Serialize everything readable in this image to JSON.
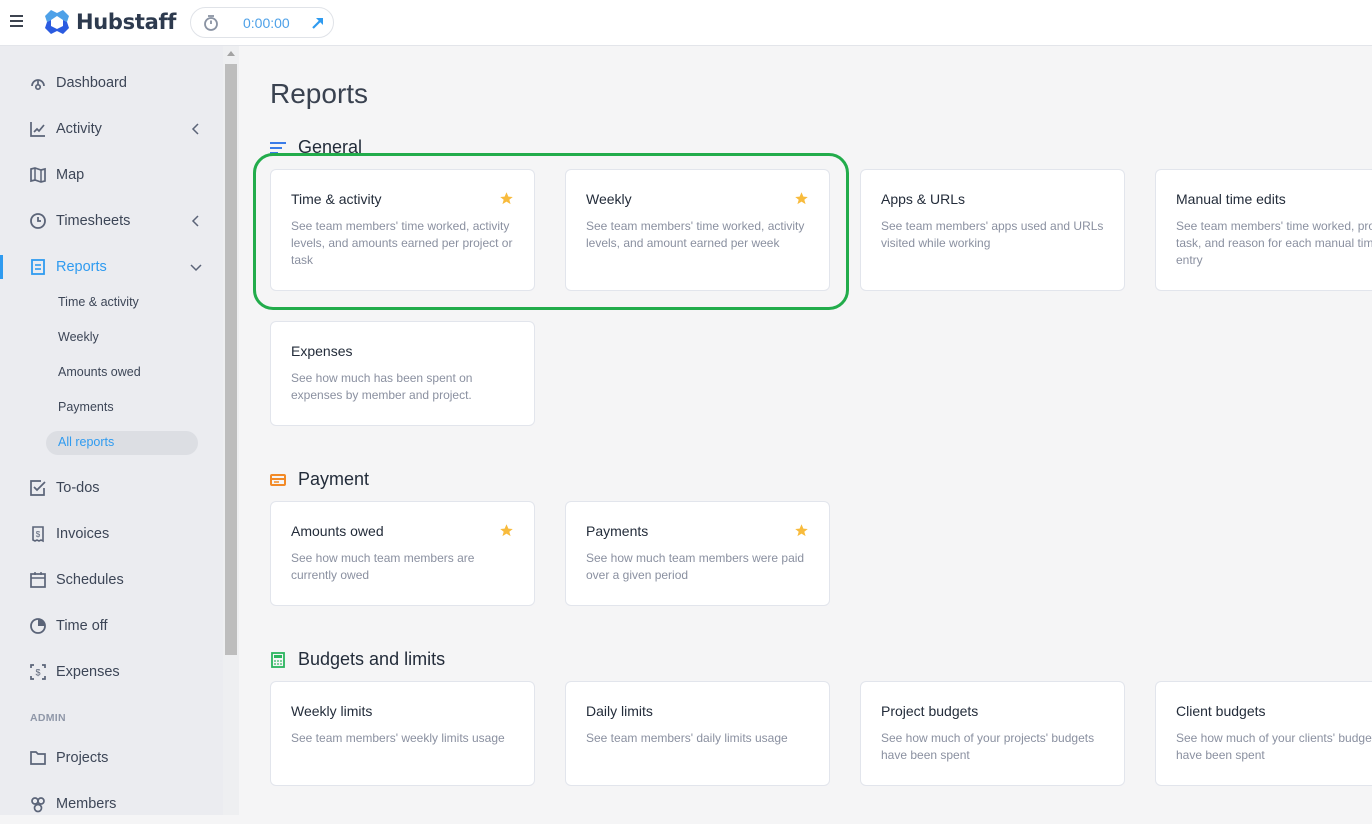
{
  "topbar": {
    "brand": "Hubstaff",
    "timer_value": "0:00:00"
  },
  "colors": {
    "accent": "#2f9bf0",
    "highlight": "#22ac4b",
    "star": "#f8bb3c",
    "payment_icon": "#f28a27",
    "budgets_icon": "#2bb55e",
    "general_icon": "#3a7ce8"
  },
  "sidebar": {
    "items": [
      {
        "label": "Dashboard",
        "icon": "dashboard-icon"
      },
      {
        "label": "Activity",
        "icon": "activity-icon",
        "chevron": "left"
      },
      {
        "label": "Map",
        "icon": "map-icon"
      },
      {
        "label": "Timesheets",
        "icon": "clock-icon",
        "chevron": "left"
      },
      {
        "label": "Reports",
        "icon": "reports-icon",
        "chevron": "down",
        "active": true
      },
      {
        "label": "To-dos",
        "icon": "todo-icon"
      },
      {
        "label": "Invoices",
        "icon": "invoice-icon"
      },
      {
        "label": "Schedules",
        "icon": "calendar-icon"
      },
      {
        "label": "Time off",
        "icon": "pie-icon"
      },
      {
        "label": "Expenses",
        "icon": "expenses-icon"
      },
      {
        "label": "Projects",
        "icon": "folder-icon"
      },
      {
        "label": "Members",
        "icon": "members-icon"
      }
    ],
    "reports_sub": [
      "Time & activity",
      "Weekly",
      "Amounts owed",
      "Payments",
      "All reports"
    ],
    "admin_header": "ADMIN"
  },
  "main": {
    "title": "Reports",
    "groups": [
      {
        "title": "General",
        "cards": [
          {
            "title": "Time & activity",
            "desc": "See team members' time worked, activity levels, and amounts earned per project or task",
            "starred": true
          },
          {
            "title": "Weekly",
            "desc": "See team members' time worked, activity levels, and amount earned per week",
            "starred": true
          },
          {
            "title": "Apps & URLs",
            "desc": "See team members' apps used and URLs visited while working",
            "starred": false
          },
          {
            "title": "Manual time edits",
            "desc": "See team members' time worked, project, task, and reason for each manual time entry",
            "starred": false
          },
          {
            "title": "Expenses",
            "desc": "See how much has been spent on expenses by member and project.",
            "starred": false
          }
        ]
      },
      {
        "title": "Payment",
        "cards": [
          {
            "title": "Amounts owed",
            "desc": "See how much team members are currently owed",
            "starred": true
          },
          {
            "title": "Payments",
            "desc": "See how much team members were paid over a given period",
            "starred": true
          }
        ]
      },
      {
        "title": "Budgets and limits",
        "cards": [
          {
            "title": "Weekly limits",
            "desc": "See team members' weekly limits usage",
            "starred": false
          },
          {
            "title": "Daily limits",
            "desc": "See team members' daily limits usage",
            "starred": false
          },
          {
            "title": "Project budgets",
            "desc": "See how much of your projects' budgets have been spent",
            "starred": false
          },
          {
            "title": "Client budgets",
            "desc": "See how much of your clients' budgets have been spent",
            "starred": false
          }
        ]
      }
    ]
  }
}
